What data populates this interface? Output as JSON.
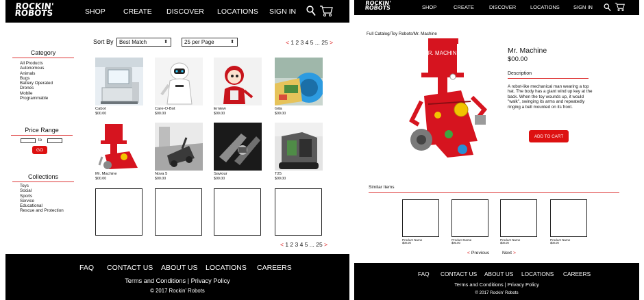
{
  "listing_page": {
    "header": {
      "logo_line1": "ROCKIN'",
      "logo_line2": "ROBOTS",
      "nav": [
        "SHOP",
        "CREATE",
        "DISCOVER",
        "LOCATIONS",
        "SIGN IN"
      ],
      "icons": [
        "search-icon",
        "cart-icon"
      ]
    },
    "sidebar": {
      "category_heading": "Category",
      "categories": [
        "All Products",
        "Autonomous",
        "Animals",
        "Bugs",
        "Battery Operated",
        "Drones",
        "Mobile",
        "Programmable"
      ],
      "price_heading": "Price Range",
      "price_to": "to",
      "go_label": "GO",
      "collections_heading": "Collections",
      "collections": [
        "Toys",
        "Social",
        "Sports",
        "Service",
        "Educational",
        "Rescue and Protection"
      ]
    },
    "toolbar": {
      "sort_label": "Sort By",
      "sort_value": "Best Match",
      "per_page_value": "25 per Page",
      "pager_prev": "<",
      "pager_pages": "1 2 3 4 5 ... 25",
      "pager_next": ">"
    },
    "products": [
      {
        "name": "Cabot",
        "price": "$00.00"
      },
      {
        "name": "Care-O-Bot",
        "price": "$00.00"
      },
      {
        "name": "Erniew",
        "price": "$00.00"
      },
      {
        "name": "Gita",
        "price": "$00.00"
      },
      {
        "name": "Mr. Machine",
        "price": "$00.00"
      },
      {
        "name": "Nova 5",
        "price": "$00.00"
      },
      {
        "name": "Saviour",
        "price": "$00.00"
      },
      {
        "name": "T25",
        "price": "$00.00"
      }
    ],
    "footer": {
      "links": [
        "FAQ",
        "CONTACT US",
        "ABOUT US",
        "LOCATIONS",
        "CAREERS"
      ],
      "terms": "Terms and Conditions",
      "separator": "|",
      "privacy": "Privacy Policy",
      "copyright": "© 2017 Rockin' Robots"
    }
  },
  "detail_page": {
    "header": {
      "logo_line1": "ROCKIN'",
      "logo_line2": "ROBOTS",
      "nav": [
        "SHOP",
        "CREATE",
        "DISCOVER",
        "LOCATIONS",
        "SIGN IN"
      ],
      "icons": [
        "search-icon",
        "cart-icon"
      ]
    },
    "breadcrumb": "Full Catalog/Toy Robots/Mr. Machine",
    "product_image_text": "MR. MACHINE",
    "product": {
      "name": "Mr. Machine",
      "price": "$00.00",
      "description_heading": "Description",
      "description": "A robot-like mechanical man wearing a top hat. The body has a giant wind up key at the back. When the toy wounds up, it would \"walk\", swinging its arms and repeatedly ringing a bell mounted on its front.",
      "add_to_cart": "ADD TO CART"
    },
    "similar": {
      "heading": "Similar Items",
      "items": [
        {
          "name": "Product Name",
          "price": "$00.00"
        },
        {
          "name": "Product Name",
          "price": "$00.00"
        },
        {
          "name": "Product Name",
          "price": "$00.00"
        },
        {
          "name": "Product Name",
          "price": "$00.00"
        }
      ],
      "prev_arrow": "<",
      "prev_label": "Previous",
      "next_label": "Next",
      "next_arrow": ">"
    },
    "footer": {
      "links": [
        "FAQ",
        "CONTACT US",
        "ABOUT US",
        "LOCATIONS",
        "CAREERS"
      ],
      "terms": "Terms and Conditions",
      "separator": "|",
      "privacy": "Privacy Policy",
      "copyright": "© 2017 Rockin' Robots"
    }
  },
  "colors": {
    "accent": "#dd1111",
    "header_bg": "#000000",
    "footer_bg": "#000000"
  }
}
